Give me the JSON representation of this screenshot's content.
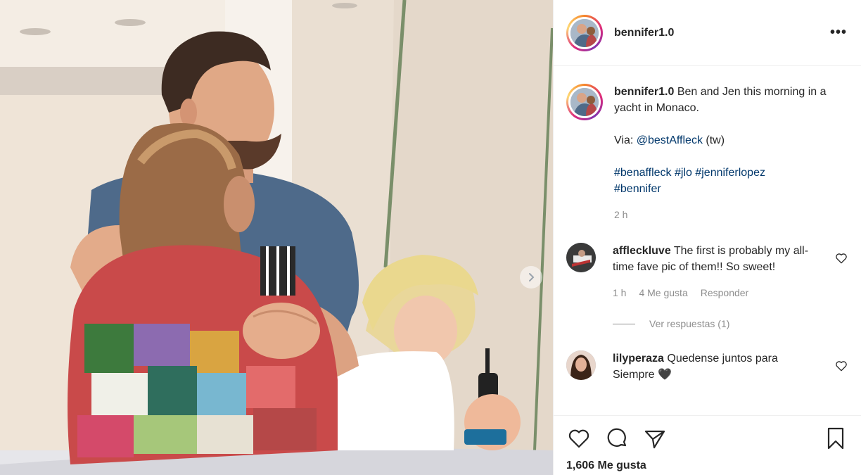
{
  "post": {
    "username": "bennifer1.0",
    "more_icon": "•••",
    "caption": {
      "username": "bennifer1.0",
      "line1": "Ben and Jen this morning in a yacht in Monaco.",
      "via_prefix": "Via: ",
      "via_handle": "@bestAffleck",
      "via_suffix": " (tw)",
      "hashtags_1": "#benaffleck #jlo #jenniferlopez",
      "hashtags_2": "#bennifer",
      "time": "2 h"
    },
    "comments": [
      {
        "username": "affleckluve",
        "text": "The first is probably my all-time fave pic of them!! So sweet!",
        "time": "1 h",
        "likes": "4 Me gusta",
        "reply": "Responder",
        "view_replies": "Ver respuestas (1)"
      },
      {
        "username": "lilyperaza",
        "text": "Quedense juntos para Siempre 🖤"
      }
    ],
    "likes_count": "1,606 Me gusta"
  },
  "icons": {
    "more": "more-options-icon",
    "heart": "heart-icon",
    "comment": "comment-icon",
    "share": "share-icon",
    "bookmark": "bookmark-icon",
    "next": "chevron-right-icon"
  },
  "colors": {
    "link": "#00376b",
    "muted": "#8e8e8e",
    "text": "#262626"
  }
}
